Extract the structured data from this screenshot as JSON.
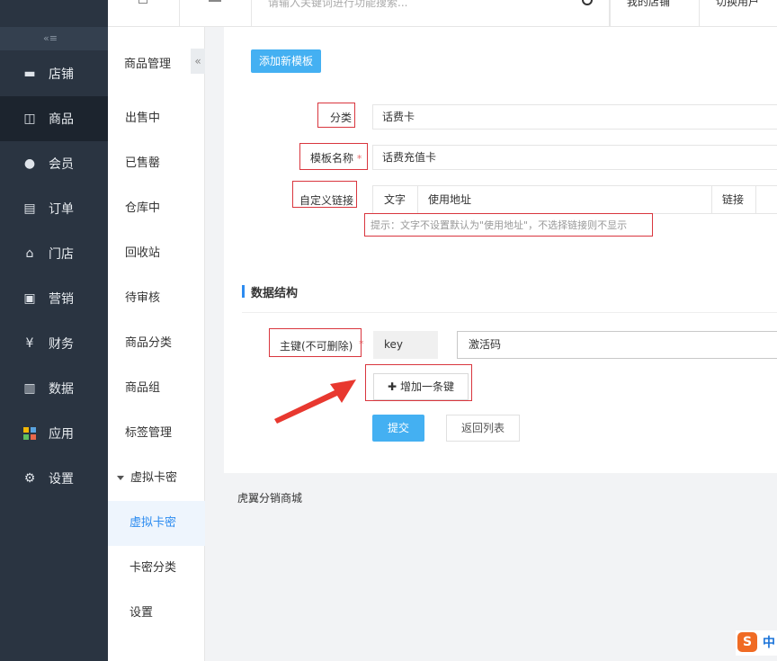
{
  "topbar": {
    "search_placeholder": "请输入关键词进行功能搜索...",
    "right_1": "我的店铺",
    "right_2": "切换用户"
  },
  "sidebar": {
    "collapse_glyph": "«≡",
    "items": [
      {
        "label": "店铺",
        "icon": "store-icon"
      },
      {
        "label": "商品",
        "icon": "shopping-bag-icon"
      },
      {
        "label": "会员",
        "icon": "user-icon"
      },
      {
        "label": "订单",
        "icon": "document-icon"
      },
      {
        "label": "门店",
        "icon": "shop-icon"
      },
      {
        "label": "营销",
        "icon": "gift-icon"
      },
      {
        "label": "财务",
        "icon": "money-bag-icon"
      },
      {
        "label": "数据",
        "icon": "bar-chart-icon"
      },
      {
        "label": "应用",
        "icon": "apps-icon"
      },
      {
        "label": "设置",
        "icon": "gear-icon"
      }
    ],
    "active_index": 1
  },
  "subnav": {
    "title": "商品管理",
    "toggle": "«",
    "items": [
      "出售中",
      "已售罄",
      "仓库中",
      "回收站",
      "待审核",
      "商品分类",
      "商品组",
      "标签管理"
    ],
    "group": "虚拟卡密",
    "children": [
      "虚拟卡密",
      "卡密分类",
      "设置"
    ],
    "active_child": 0
  },
  "form": {
    "add_template_button": "添加新模板",
    "category_label": "分类",
    "category_value": "话费卡",
    "template_name_label": "模板名称",
    "required_mark": "*",
    "template_name_value": "话费充值卡",
    "custom_link_label": "自定义链接",
    "link_table": {
      "col_text": "文字",
      "col_value": "使用地址",
      "col_link": "链接"
    },
    "hint": "提示：文字不设置默认为\"使用地址\"，不选择链接则不显示"
  },
  "data_structure": {
    "section_title": "数据结构",
    "primary_key_label": "主键(不可删除)",
    "key_name": "key",
    "key_value": "激活码",
    "add_key_button": "增加一条键"
  },
  "actions": {
    "submit": "提交",
    "back": "返回列表"
  },
  "footer": "虎翼分销商城",
  "ime": {
    "logo": "S",
    "mode": "中"
  },
  "colors": {
    "sidebar_bg": "#2a3441",
    "accent_blue": "#44b0f2",
    "highlight_red": "#d9363e",
    "arrow_red": "#e8382f"
  }
}
